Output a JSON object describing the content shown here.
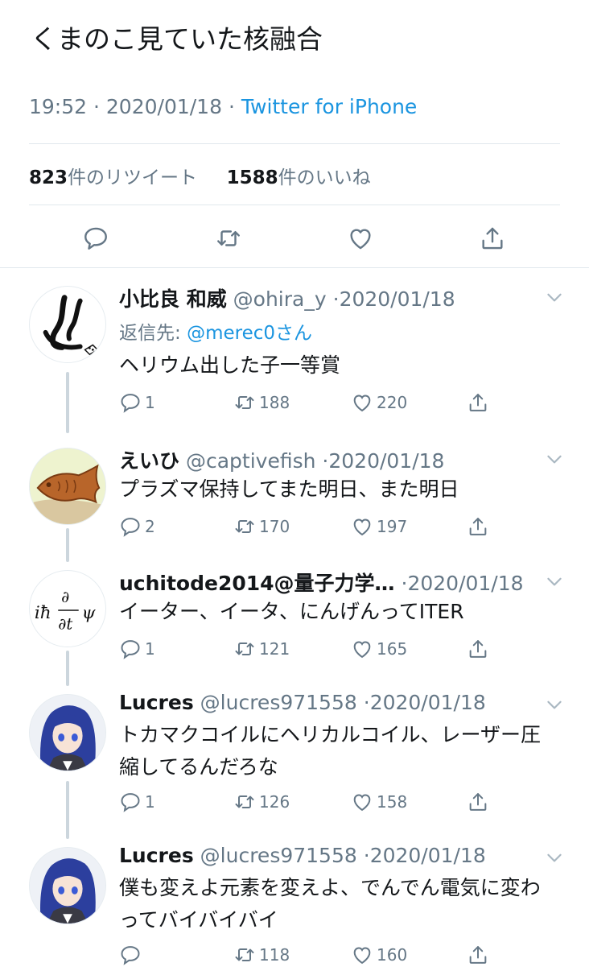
{
  "tweet": {
    "text": "くまのこ見ていた核融合",
    "time": "19:52",
    "date": "2020/01/18",
    "source": "Twitter for iPhone",
    "retweet_count": "823",
    "retweet_label": "件のリツイート",
    "like_count": "1588",
    "like_label": "件のいいね"
  },
  "replies": [
    {
      "name": "小比良 和威",
      "handle": "@ohira_y",
      "date": "2020/01/18",
      "reply_to_label": "返信先: ",
      "reply_to_handle": "@merec0",
      "reply_to_suffix": "さん",
      "text": "ヘリウム出した子一等賞",
      "replies": "1",
      "retweets": "188",
      "likes": "220"
    },
    {
      "name": "えいひ",
      "handle": "@captivefish",
      "date": "2020/01/18",
      "text": "プラズマ保持してまた明日、また明日",
      "replies": "2",
      "retweets": "170",
      "likes": "197"
    },
    {
      "name": "uchitode2014@量子力学…",
      "handle": "",
      "date": "2020/01/18",
      "text": "イーター、イータ、にんげんってITER",
      "replies": "1",
      "retweets": "121",
      "likes": "165"
    },
    {
      "name": "Lucres",
      "handle": "@lucres971558",
      "date": "2020/01/18",
      "text": "トカマクコイルにヘリカルコイル、レーザー圧縮してるんだろな",
      "replies": "1",
      "retweets": "126",
      "likes": "158"
    },
    {
      "name": "Lucres",
      "handle": "@lucres971558",
      "date": "2020/01/18",
      "text": "僕も変えよ元素を変えよ、でんでん電気に変わってバイバイバイ",
      "replies": "",
      "retweets": "118",
      "likes": "160"
    }
  ],
  "colors": {
    "link": "#1b95e0",
    "muted": "#657786",
    "divider": "#e1e8ed"
  },
  "icons": [
    "reply-icon",
    "retweet-icon",
    "like-icon",
    "share-icon",
    "chevron-down-icon"
  ]
}
